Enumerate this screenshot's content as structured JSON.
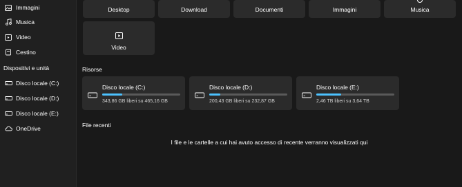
{
  "sidebar": {
    "items_top": [
      {
        "label": "Immagini",
        "icon": "image-icon"
      },
      {
        "label": "Musica",
        "icon": "music-note-icon"
      },
      {
        "label": "Video",
        "icon": "video-icon"
      },
      {
        "label": "Cestino",
        "icon": "trash-icon"
      }
    ],
    "section_label": "Dispositivi e unità",
    "items_drives": [
      {
        "label": "Disco locale (C:)",
        "icon": "drive-icon"
      },
      {
        "label": "Disco locale (D:)",
        "icon": "drive-icon"
      },
      {
        "label": "Disco locale (E:)",
        "icon": "drive-icon"
      },
      {
        "label": "OneDrive",
        "icon": "cloud-icon"
      }
    ]
  },
  "folders": [
    {
      "name": "Desktop"
    },
    {
      "name": "Download"
    },
    {
      "name": "Documenti"
    },
    {
      "name": "Immagini"
    },
    {
      "name": "Musica"
    },
    {
      "name": "Video",
      "icon": "video-icon"
    }
  ],
  "resources": {
    "title": "Risorse",
    "drives": [
      {
        "name": "Disco locale (C:)",
        "info": "343,86 GB liberi su 465,16 GB",
        "used_fraction": 0.26
      },
      {
        "name": "Disco locale (D:)",
        "info": "200,43 GB liberi su 232,87 GB",
        "used_fraction": 0.14
      },
      {
        "name": "Disco locale (E:)",
        "info": "2,46 TB liberi su 3,64 TB",
        "used_fraction": 0.32
      }
    ]
  },
  "recent": {
    "title": "File recenti",
    "empty_message": "I file e le cartelle a cui hai avuto accesso di recente verranno visualizzati qui"
  },
  "colors": {
    "accent": "#4cc2ff",
    "background": "#191919",
    "card": "#2b2b2b",
    "sidebar": "#202020"
  }
}
